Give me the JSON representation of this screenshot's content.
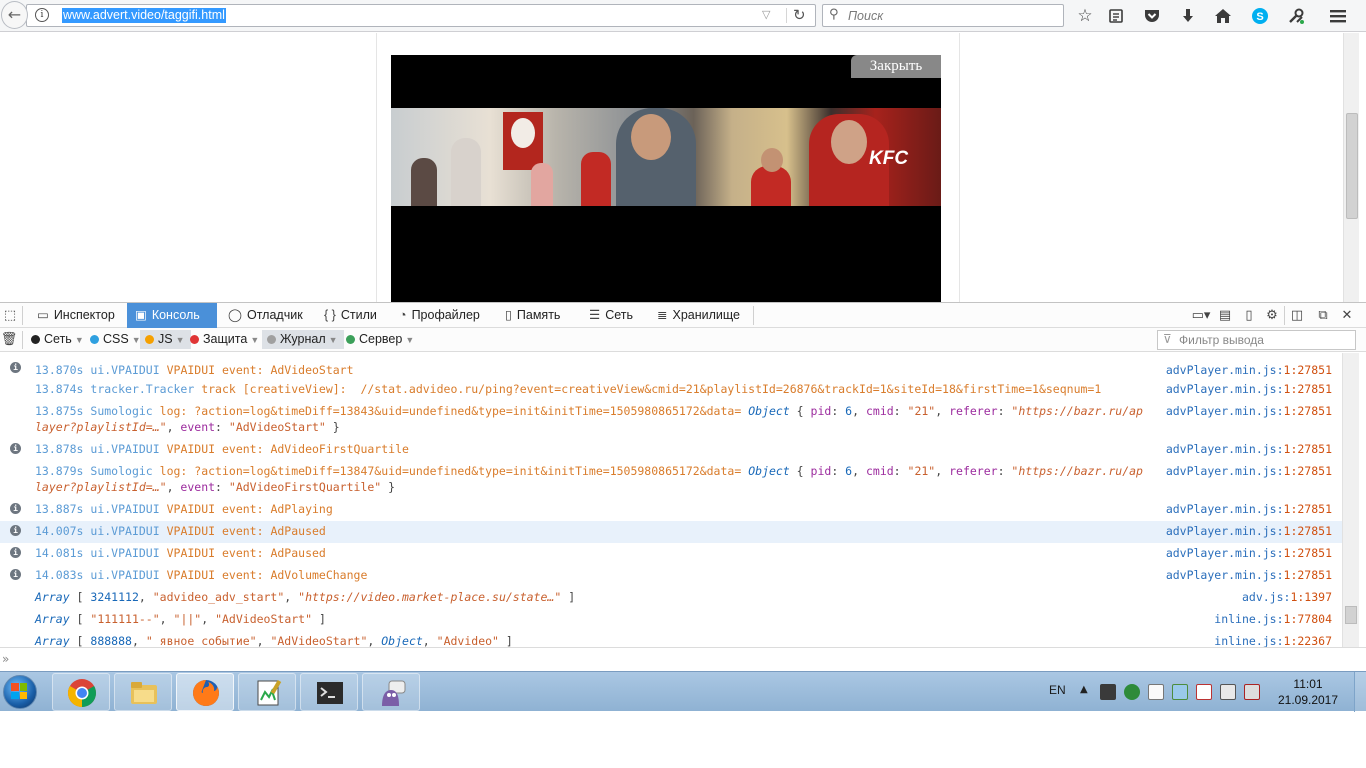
{
  "browser": {
    "url": "www.advert.video/taggifi.html",
    "search_placeholder": "Поиск"
  },
  "page": {
    "close_label": "Закрыть"
  },
  "devtools": {
    "tabs": [
      {
        "label": "Инспектор",
        "icon": "inspector-icon"
      },
      {
        "label": "Консоль",
        "icon": "console-icon",
        "active": true
      },
      {
        "label": "Отладчик",
        "icon": "debugger-icon"
      },
      {
        "label": "Стили",
        "icon": "styles-icon"
      },
      {
        "label": "Профайлер",
        "icon": "profiler-icon"
      },
      {
        "label": "Память",
        "icon": "memory-icon"
      },
      {
        "label": "Сеть",
        "icon": "network-icon"
      },
      {
        "label": "Хранилище",
        "icon": "storage-icon"
      }
    ],
    "filters": [
      {
        "label": "Сеть",
        "color": "#222222"
      },
      {
        "label": "CSS",
        "color": "#2fa0e0"
      },
      {
        "label": "JS",
        "color": "#f5a000",
        "on": true
      },
      {
        "label": "Защита",
        "color": "#e03535"
      },
      {
        "label": "Журнал",
        "color": "#a0a0a0",
        "on": true
      },
      {
        "label": "Сервер",
        "color": "#3ca05a"
      }
    ],
    "filter_placeholder": "Фильтр вывода"
  },
  "console": {
    "rows": [
      {
        "ts": "13.870s",
        "module": "ui.VPAIDUI",
        "text": "VPAIDUI event: AdVideoStart",
        "source": "advPlayer.min.js",
        "line": "1:27851"
      },
      {
        "ts": "13.874s",
        "module": "tracker.Tracker",
        "text": "track [creativeView]:  //stat.advideo.ru/ping?event=creativeView&cmid=21&playlistId=26876&trackId=1&siteId=18&firstTime=1&seqnum=1",
        "source": "advPlayer.min.js",
        "line": "1:27851"
      },
      {
        "ts": "13.875s",
        "module": "Sumologic",
        "text": "log: ?action=log&timeDiff=13843&uid=undefined&type=init&initTime=1505980865172&data=",
        "pid": "6",
        "cmid": "\"21\"",
        "referer": "\"https://bazr.ru/aplayer?playlistId=…\"",
        "event": "\"AdVideoStart\"",
        "source": "advPlayer.min.js",
        "line": "1:27851"
      },
      {
        "ts": "13.878s",
        "module": "ui.VPAIDUI",
        "text": "VPAIDUI event: AdVideoFirstQuartile",
        "source": "advPlayer.min.js",
        "line": "1:27851"
      },
      {
        "ts": "13.879s",
        "module": "Sumologic",
        "text": "log: ?action=log&timeDiff=13847&uid=undefined&type=init&initTime=1505980865172&data=",
        "pid": "6",
        "cmid": "\"21\"",
        "referer": "\"https://bazr.ru/aplayer?playlistId=…\"",
        "event": "\"AdVideoFirstQuartile\"",
        "source": "advPlayer.min.js",
        "line": "1:27851"
      },
      {
        "ts": "13.887s",
        "module": "ui.VPAIDUI",
        "text": "VPAIDUI event: AdPlaying",
        "source": "advPlayer.min.js",
        "line": "1:27851"
      },
      {
        "ts": "14.007s",
        "module": "ui.VPAIDUI",
        "text": "VPAIDUI event: AdPaused",
        "source": "advPlayer.min.js",
        "line": "1:27851"
      },
      {
        "ts": "14.081s",
        "module": "ui.VPAIDUI",
        "text": "VPAIDUI event: AdPaused",
        "source": "advPlayer.min.js",
        "line": "1:27851"
      },
      {
        "ts": "14.083s",
        "module": "ui.VPAIDUI",
        "text": "VPAIDUI event: AdVolumeChange",
        "source": "advPlayer.min.js",
        "line": "1:27851"
      }
    ],
    "arrays": [
      {
        "num": "3241112",
        "s1": "\"advideo_adv_start\"",
        "s2": "\"https://video.market-place.su/state…\"",
        "source": "adv.js",
        "line": "1:1397"
      },
      {
        "s1": "\"111111--\"",
        "s2": "\"||\"",
        "s3": "\"AdVideoStart\"",
        "source": "inline.js",
        "line": "1:77804"
      },
      {
        "num": "888888",
        "s1": "\" явное событие\"",
        "s2": "\"AdVideoStart\"",
        "obj": "Object",
        "s3": "\"Advideo\"",
        "source": "inline.js",
        "line": "1:22367"
      }
    ]
  },
  "taskbar": {
    "lang": "EN",
    "time": "11:01",
    "date": "21.09.2017"
  }
}
